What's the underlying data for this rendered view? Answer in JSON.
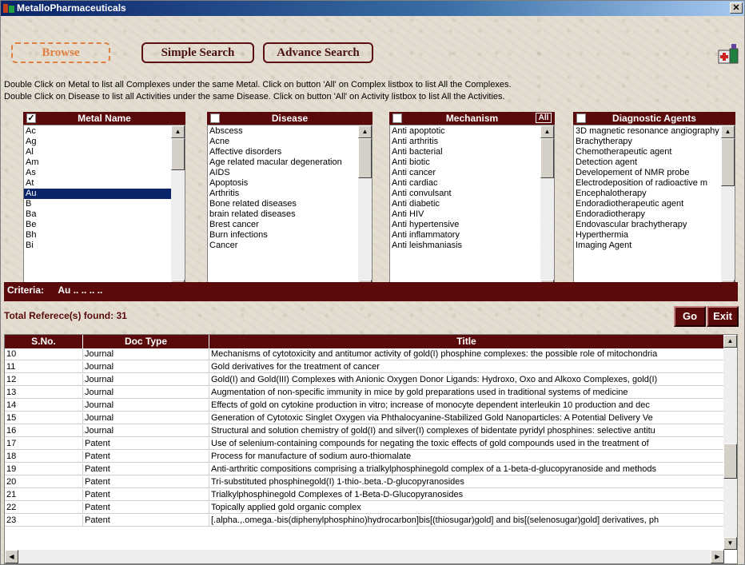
{
  "window": {
    "title": "MetalloPharmaceuticals"
  },
  "tabs": [
    {
      "label": "Browse",
      "active": true
    },
    {
      "label": "Simple Search",
      "active": false
    },
    {
      "label": "Advance Search",
      "active": false
    }
  ],
  "instructions": [
    "Double Click on Metal to list all Complexes under the same Metal. Click on button 'All' on Complex listbox to list All the Complexes.",
    "Double Click on Disease to list all Activities under the same Disease. Click on button 'All' on Activity listbox to list All the Activities."
  ],
  "panels": {
    "metal": {
      "header": "Metal Name",
      "checked": true,
      "items": [
        "Ac",
        "Ag",
        "Al",
        "Am",
        "As",
        "At",
        "Au",
        "B",
        "Ba",
        "Be",
        "Bh",
        "Bi"
      ],
      "selected_index": 6
    },
    "disease": {
      "header": "Disease",
      "checked": false,
      "items": [
        "Abscess",
        "Acne",
        "Affective disorders",
        "Age related macular degeneration",
        "AIDS",
        "Apoptosis",
        "Arthritis",
        "Bone related diseases",
        "brain related diseases",
        "Brest cancer",
        "Burn infections",
        "Cancer"
      ]
    },
    "mechanism": {
      "header": "Mechanism",
      "checked": false,
      "all_button": "All",
      "items": [
        "Anti apoptotic",
        "Anti arthritis",
        "Anti bacterial",
        "Anti biotic",
        "Anti cancer",
        "Anti cardiac",
        "Anti convulsant",
        "Anti diabetic",
        "Anti HIV",
        "Anti hypertensive",
        "Anti inflammatory",
        "Anti leishmaniasis"
      ]
    },
    "diagnostic": {
      "header": "Diagnostic Agents",
      "checked": false,
      "items": [
        "3D magnetic resonance angiography",
        "Brachytherapy",
        "Chemotherapeutic agent",
        "Detection agent",
        "Developement of NMR probe",
        "Electrodeposition of radioactive m",
        "Encephalotherapy",
        "Endoradiotherapeutic agent",
        "Endoradiotherapy",
        "Endovascular brachytherapy",
        "Hyperthermia",
        "Imaging Agent"
      ]
    }
  },
  "criteria": {
    "label": "Criteria:",
    "value": "Au ..   ..   ..   .."
  },
  "total": {
    "text": "Total Referece(s) found: 31"
  },
  "buttons": {
    "go": "Go",
    "exit": "Exit"
  },
  "grid": {
    "headers": {
      "sno": "S.No.",
      "doc_type": "Doc Type",
      "title": "Title"
    },
    "rows": [
      {
        "sno": "10",
        "type": "Journal",
        "title": "Mechanisms of cytotoxicity and antitumor activity of gold(I) phosphine complexes: the possible role of mitochondria"
      },
      {
        "sno": "11",
        "type": "Journal",
        "title": "Gold derivatives for the treatment of cancer"
      },
      {
        "sno": "12",
        "type": "Journal",
        "title": "Gold(I) and Gold(III) Complexes with Anionic Oxygen Donor Ligands: Hydroxo, Oxo and Alkoxo Complexes, gold(I)"
      },
      {
        "sno": "13",
        "type": "Journal",
        "title": "Augmentation of non-specific immunity in mice by gold preparations used in traditional systems of medicine"
      },
      {
        "sno": "14",
        "type": "Journal",
        "title": "Effects of gold on cytokine production in vitro; increase of monocyte dependent interleukin 10 production and dec"
      },
      {
        "sno": "15",
        "type": "Journal",
        "title": "Generation of Cytotoxic Singlet Oxygen via Phthalocyanine-Stabilized Gold Nanoparticles: A Potential Delivery Ve"
      },
      {
        "sno": "16",
        "type": "Journal",
        "title": "Structural and solution chemistry of gold(I) and silver(I) complexes of bidentate pyridyl phosphines: selective antitu"
      },
      {
        "sno": "17",
        "type": "Patent",
        "title": "Use of selenium-containing compounds for negating the toxic effects of gold compounds used in the treatment of"
      },
      {
        "sno": "18",
        "type": "Patent",
        "title": "Process for manufacture of sodium auro-thiomalate"
      },
      {
        "sno": "19",
        "type": "Patent",
        "title": "Anti-arthritic compositions comprising a trialkylphosphinegold complex of a 1-beta-d-glucopyranoside and methods"
      },
      {
        "sno": "20",
        "type": "Patent",
        "title": "Tri-substituted phosphinegold(I) 1-thio-.beta.-D-glucopyranosides"
      },
      {
        "sno": "21",
        "type": "Patent",
        "title": "Trialkylphosphinegold Complexes of 1-Beta-D-Glucopyranosides"
      },
      {
        "sno": "22",
        "type": "Patent",
        "title": "Topically applied gold organic complex"
      },
      {
        "sno": "23",
        "type": "Patent",
        "title": "[.alpha.,.omega.-bis(diphenylphosphino)hydrocarbon]bis[(thiosugar)gold] and bis[(selenosugar)gold] derivatives, ph"
      }
    ]
  },
  "icons": {
    "app": "app-icon",
    "close": "close-icon",
    "kit": "medicine-kit-icon",
    "up": "scroll-up-icon",
    "down": "scroll-down-icon",
    "left": "scroll-left-icon",
    "right": "scroll-right-icon"
  },
  "colors": {
    "header_bg": "#5a0a0a",
    "active_tab": "#e08040",
    "selection": "#0a246a"
  }
}
